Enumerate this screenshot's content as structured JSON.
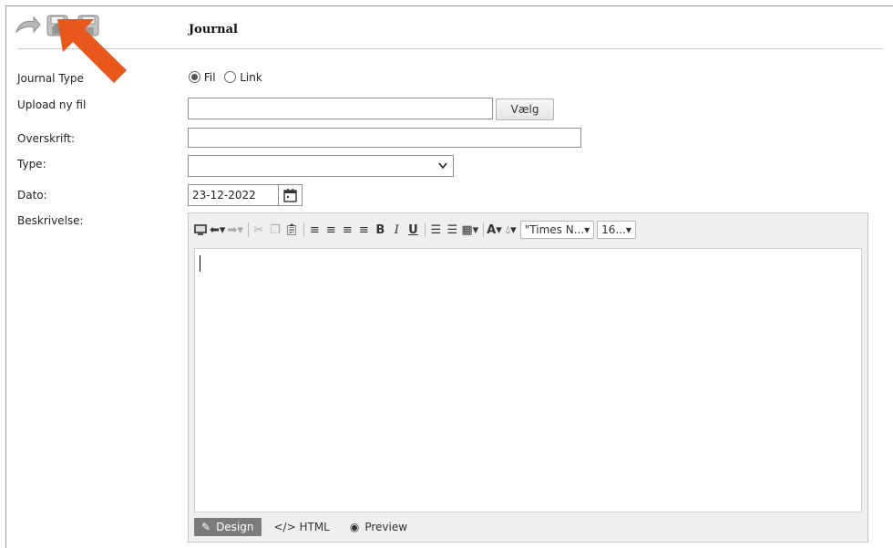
{
  "header": {
    "title": "Journal"
  },
  "toolbar": {
    "icons": [
      "undo-icon",
      "save-new-icon",
      "save-icon"
    ]
  },
  "form": {
    "journal_type": {
      "label": "Journal Type",
      "options": [
        "Fil",
        "Link"
      ],
      "selected": "Fil"
    },
    "upload": {
      "label": "Upload ny fil",
      "value": "",
      "button": "Vælg"
    },
    "overskrift": {
      "label": "Overskrift:",
      "value": ""
    },
    "type": {
      "label": "Type:",
      "value": ""
    },
    "dato": {
      "label": "Dato:",
      "value": "23-12-2022"
    },
    "beskrivelse": {
      "label": "Beskrivelse:"
    }
  },
  "editor": {
    "font_name": "\"Times N...",
    "font_size": "16...",
    "modes": [
      "Design",
      "</> HTML",
      "Preview"
    ],
    "active_mode": "Design"
  },
  "colors": {
    "arrow": "#e8581c",
    "active_mode_bg": "#7b7b7b"
  }
}
